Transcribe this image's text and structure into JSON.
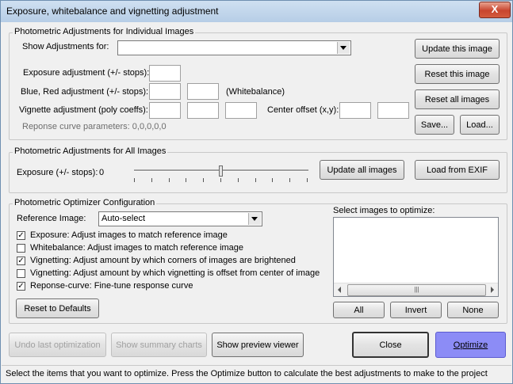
{
  "window": {
    "title": "Exposure, whitebalance and vignetting adjustment",
    "close_glyph": "X"
  },
  "individual": {
    "legend": "Photometric Adjustments for Individual Images",
    "show_label": "Show Adjustments for:",
    "show_value": "",
    "exposure_label": "Exposure adjustment (+/- stops):",
    "bluered_label": "Blue, Red adjustment (+/- stops):",
    "whitebalance_label": "(Whitebalance)",
    "vignette_label": "Vignette adjustment (poly coeffs):",
    "center_label": "Center offset (x,y):",
    "response_label": "Reponse curve parameters: 0,0,0,0,0",
    "update_this": "Update this image",
    "reset_this": "Reset this image",
    "reset_all": "Reset all images",
    "save": "Save...",
    "load": "Load..."
  },
  "all": {
    "legend": "Photometric Adjustments for All Images",
    "exposure_label": "Exposure (+/- stops):",
    "exposure_value": "0",
    "slider_level": 0.5,
    "update_all": "Update all images",
    "load_exif": "Load from EXIF"
  },
  "optimizer": {
    "legend": "Photometric Optimizer Configuration",
    "ref_label": "Reference Image:",
    "ref_value": "Auto-select",
    "options": [
      {
        "label": "Exposure:  Adjust images to match reference image",
        "checked": true
      },
      {
        "label": "Whitebalance:  Adjust images to match reference image",
        "checked": false
      },
      {
        "label": "Vignetting:  Adjust amount by which corners of images are brightened",
        "checked": true
      },
      {
        "label": "Vignetting:  Adjust amount by which vignetting is offset from center of image",
        "checked": false
      },
      {
        "label": "Reponse-curve: Fine-tune response curve",
        "checked": true
      }
    ],
    "reset_defaults": "Reset to Defaults",
    "select_label": "Select images to optimize:",
    "all": "All",
    "invert": "Invert",
    "none": "None",
    "scroll_grip": "|||"
  },
  "bottom": {
    "undo": "Undo last optimization",
    "summary": "Show summary charts",
    "preview": "Show preview viewer",
    "close": "Close",
    "optimize": "Optimize"
  },
  "status": "Select the items that you want to optimize.  Press the Optimize button to calculate the best adjustments to make to the project"
}
